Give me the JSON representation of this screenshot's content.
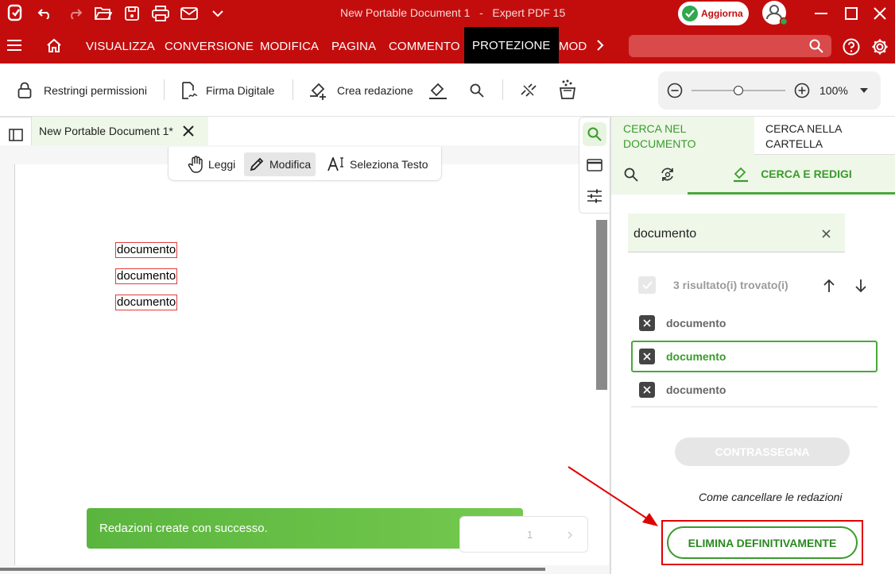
{
  "app": {
    "title": "New Portable Document 1   -   Expert PDF 15",
    "update_label": "Aggiorna"
  },
  "menu": {
    "tabs": [
      {
        "label": "VISUALIZZA"
      },
      {
        "label": "CONVERSIONE"
      },
      {
        "label": "MODIFICA"
      },
      {
        "label": "PAGINA"
      },
      {
        "label": "COMMENTO"
      },
      {
        "label": "PROTEZIONE",
        "active": true
      },
      {
        "label": "MOD"
      }
    ]
  },
  "toolbar": {
    "restrict_label": "Restringi permissioni",
    "sign_label": "Firma Digitale",
    "redact_label": "Crea redazione",
    "zoom_value": "100%",
    "zoom_level": 0.5
  },
  "document": {
    "tab_label": "New Portable Document 1*",
    "modes": [
      {
        "label": "Leggi"
      },
      {
        "label": "Modifica",
        "selected": true
      },
      {
        "label": "Seleziona Testo"
      }
    ],
    "hits": [
      "documento",
      "documento",
      "documento"
    ],
    "toast": "Redazioni create con successo.",
    "page_number": "1"
  },
  "panel": {
    "tab_search_document": "CERCA NEL DOCUMENTO",
    "tab_search_folder": "CERCA NELLA CARTELLA",
    "subtab_search_redact": "CERCA E REDIGI",
    "search_value": "documento",
    "results_summary": "3 risultato(i) trovato(i)",
    "results": [
      {
        "text": "documento",
        "active": false
      },
      {
        "text": "documento",
        "active": true
      },
      {
        "text": "documento",
        "active": false
      }
    ],
    "mark_button": "CONTRASSEGNA",
    "how_to_link": "Come cancellare le redazioni",
    "delete_button": "ELIMINA DEFINITIVAMENTE"
  },
  "colors": {
    "brand_red": "#c30d0d",
    "accent_green": "#3a9b2c",
    "toast_green": "#5ab53e",
    "annotation_red": "#e00000"
  }
}
